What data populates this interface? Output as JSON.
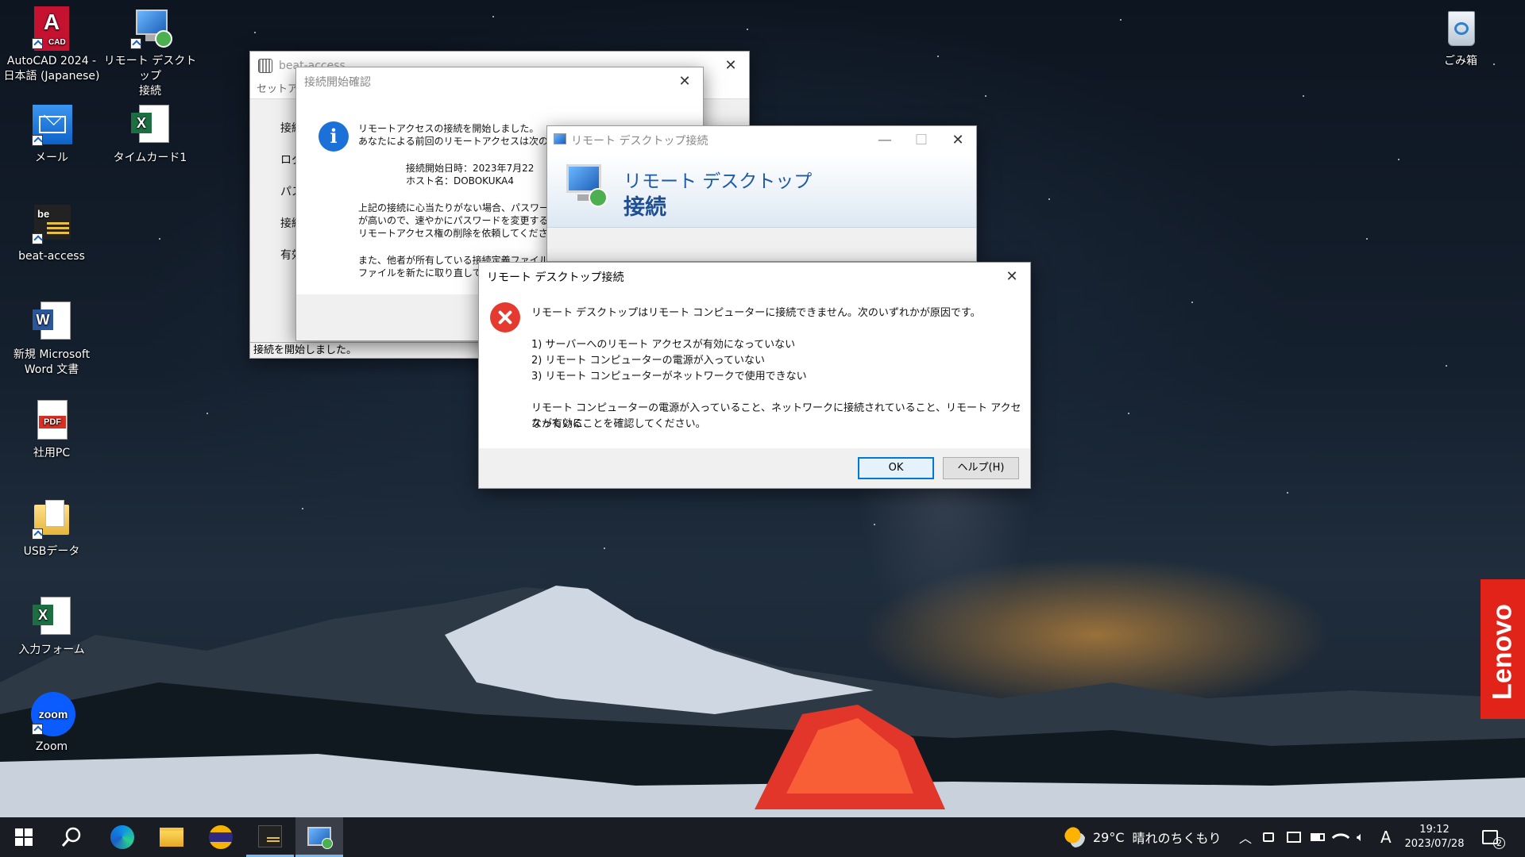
{
  "desktop": {
    "icons": [
      {
        "label": "AutoCAD 2024 -\n日本語 (Japanese)",
        "icon": "autocad-icon",
        "badge": "A",
        "sub": "CAD"
      },
      {
        "label": "リモート デスクトップ\n接続",
        "icon": "remote-desktop-icon"
      },
      {
        "label": "メール",
        "icon": "mail-icon"
      },
      {
        "label": "タイムカード1",
        "icon": "excel-icon",
        "badge": "X"
      },
      {
        "label": "beat-access",
        "icon": "beat-access-icon",
        "badge": "be"
      },
      {
        "label": "新規 Microsoft\nWord 文書",
        "icon": "word-icon",
        "badge": "W"
      },
      {
        "label": "社用PC",
        "icon": "pdf-icon",
        "badge": "PDF"
      },
      {
        "label": "USBデータ",
        "icon": "folder-icon"
      },
      {
        "label": "入力フォーム",
        "icon": "excel-icon",
        "badge": "X"
      },
      {
        "label": "Zoom",
        "icon": "zoom-icon",
        "badge": "zoom"
      },
      {
        "label": "ごみ箱",
        "icon": "recycle-bin-icon"
      }
    ]
  },
  "beat_access": {
    "title": "beat-access",
    "menu": "セットア",
    "fragments": [
      "接続",
      "ログ",
      "パス",
      "接続",
      "有効"
    ],
    "status": "接続を開始しました。"
  },
  "confirm_dialog": {
    "title": "接続開始確認",
    "line1": "リモートアクセスの接続を開始しました。",
    "line2": "あなたによる前回のリモートアクセスは次のとお",
    "start_time": "接続開始日時：2023年7月22",
    "host": "ホスト名：DOBOKUKA4",
    "warn1": "上記の接続に心当たりがない場合、パスワー",
    "warn2": "が高いので、速やかにパスワードを変更するか、",
    "warn3": "リモートアクセス権の削除を依頼してください。",
    "warn4": "また、他者が所有している接続定義ファイルを",
    "warn5": "ファイルを新たに取り直してく"
  },
  "rdc_window": {
    "title": "リモート デスクトップ接続",
    "banner_line1": "リモート デスクトップ",
    "banner_line2": "接続"
  },
  "error_dialog": {
    "title": "リモート デスクトップ接続",
    "message": "リモート デスクトップはリモート コンピューターに接続できません。次のいずれかが原因です。",
    "reasons": [
      "1) サーバーへのリモート アクセスが有効になっていない",
      "2) リモート コンピューターの電源が入っていない",
      "3) リモート コンピューターがネットワークで使用できない"
    ],
    "note1": "リモート コンピューターの電源が入っていること、ネットワークに接続されていること、リモート アクセスが有効に",
    "note2": "なっていることを確認してください。",
    "ok_label": "OK",
    "help_label": "ヘルプ(H)"
  },
  "brand": "Lenovo",
  "taskbar": {
    "weather_temp": "29°C",
    "weather_text": "晴れのちくもり",
    "ime": "A",
    "time": "19:12",
    "date": "2023/07/28",
    "notification_count": "2"
  },
  "colors": {
    "accent": "#0078d7",
    "error": "#e43a2f",
    "info": "#1c71d8",
    "lenovo": "#e2231a",
    "taskbar": "#191c22"
  }
}
